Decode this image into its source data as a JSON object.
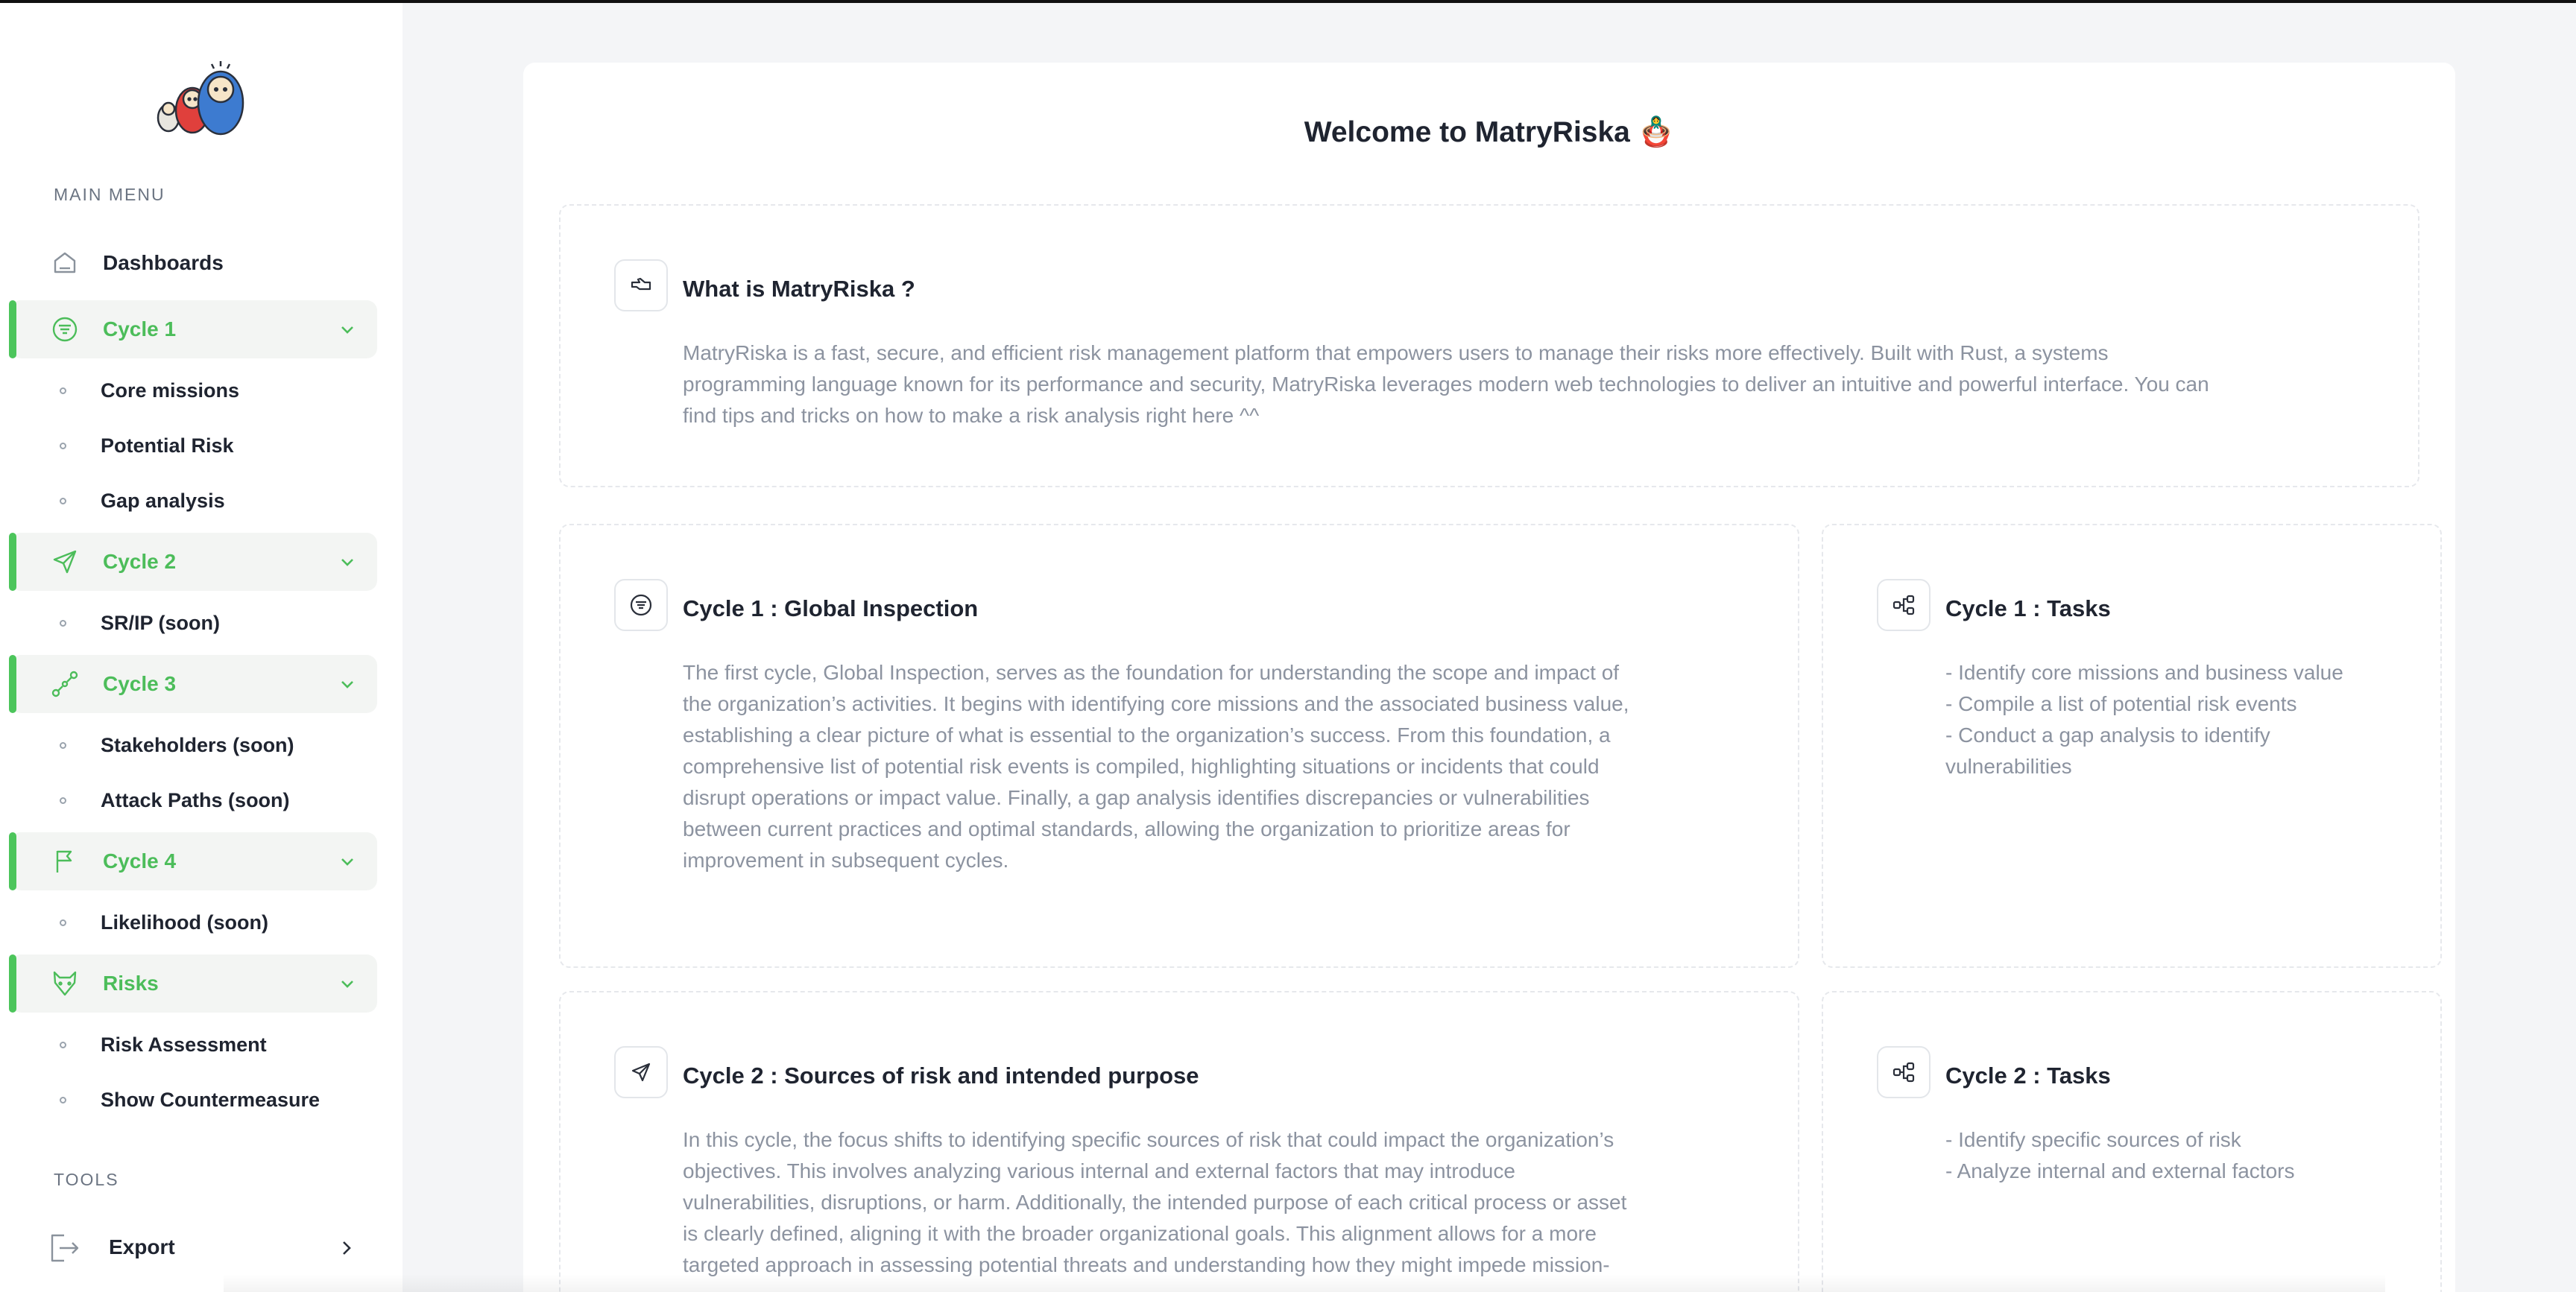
{
  "sidebar": {
    "main_menu_label": "MAIN MENU",
    "tools_label": "TOOLS",
    "items": {
      "dashboards": "Dashboards",
      "cycle1": "Cycle 1",
      "cycle2": "Cycle 2",
      "cycle3": "Cycle 3",
      "cycle4": "Cycle 4",
      "risks": "Risks"
    },
    "sub": {
      "core_missions": "Core missions",
      "potential_risk": "Potential Risk",
      "gap_analysis": "Gap analysis",
      "sr_ip": "SR/IP (soon)",
      "stakeholders": "Stakeholders (soon)",
      "attack_paths": "Attack Paths (soon)",
      "likelihood": "Likelihood (soon)",
      "risk_assessment": "Risk Assessment",
      "show_countermeasure": "Show Countermeasure"
    },
    "export": "Export"
  },
  "main": {
    "title": "Welcome to MatryRiska 🪆",
    "what": {
      "title": "What is MatryRiska ?",
      "lines": [
        "MatryRiska is a fast, secure, and efficient risk management platform that empowers users to manage their risks more effectively. Built with Rust, a systems",
        "programming language known for its performance and security, MatryRiska leverages modern web technologies to deliver an intuitive and powerful interface. You can",
        "find tips and tricks on how to make a risk analysis right here ^^"
      ]
    },
    "cycle1": {
      "title": "Cycle 1 : Global Inspection",
      "lines": [
        "The first cycle, Global Inspection, serves as the foundation for understanding the scope and impact of",
        "the organization’s activities. It begins with identifying core missions and the associated business value,",
        "establishing a clear picture of what is essential to the organization’s success. From this foundation, a",
        "comprehensive list of potential risk events is compiled, highlighting situations or incidents that could",
        "disrupt operations or impact value. Finally, a gap analysis identifies discrepancies or vulnerabilities",
        "between current practices and optimal standards, allowing the organization to prioritize areas for",
        "improvement in subsequent cycles."
      ]
    },
    "cycle1_tasks": {
      "title": "Cycle 1 : Tasks",
      "lines": [
        "- Identify core missions and business value",
        "- Compile a list of potential risk events",
        "- Conduct a gap analysis to identify",
        "vulnerabilities"
      ]
    },
    "cycle2": {
      "title": "Cycle 2 : Sources of risk and intended purpose",
      "lines": [
        "In this cycle, the focus shifts to identifying specific sources of risk that could impact the organization’s",
        "objectives. This involves analyzing various internal and external factors that may introduce",
        "vulnerabilities, disruptions, or harm. Additionally, the intended purpose of each critical process or asset",
        "is clearly defined, aligning it with the broader organizational goals. This alignment allows for a more",
        "targeted approach in assessing potential threats and understanding how they might impede mission-"
      ]
    },
    "cycle2_tasks": {
      "title": "Cycle 2 : Tasks",
      "lines": [
        "- Identify specific sources of risk",
        "- Analyze internal and external factors"
      ]
    }
  },
  "colors": {
    "accent": "#4cbd5a",
    "text": "#1f2430",
    "muted": "#8c93a0"
  }
}
